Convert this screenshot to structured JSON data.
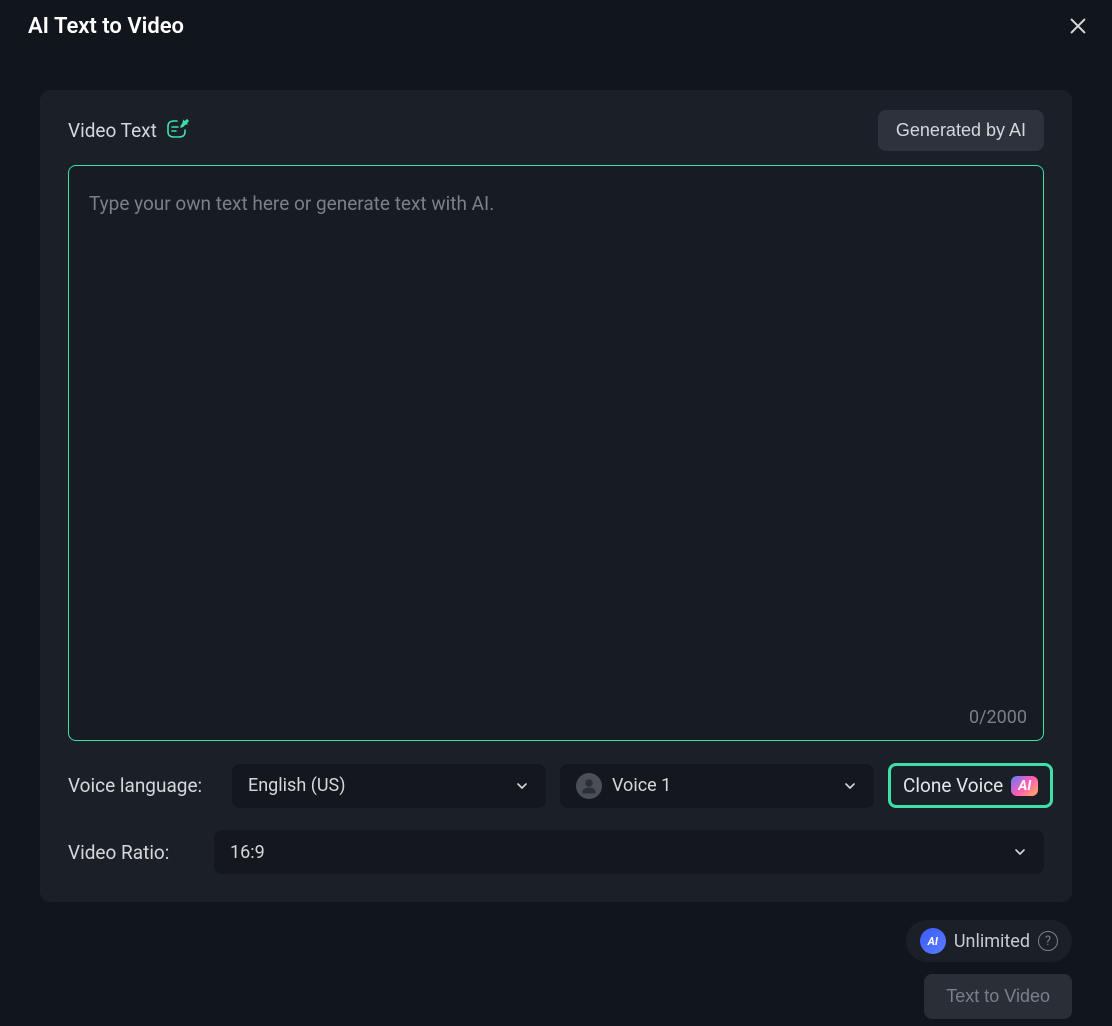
{
  "header": {
    "title": "AI Text to Video"
  },
  "videoText": {
    "label": "Video Text",
    "generateButton": "Generated by AI",
    "placeholder": "Type your own text here or generate text with AI.",
    "value": "",
    "counter": "0/2000"
  },
  "voice": {
    "languageLabel": "Voice language:",
    "languageSelected": "English (US)",
    "voiceSelected": "Voice 1",
    "cloneLabel": "Clone Voice",
    "aiBadge": "AI"
  },
  "ratio": {
    "label": "Video Ratio:",
    "selected": "16:9"
  },
  "footer": {
    "unlimited": "Unlimited",
    "aiBadge": "AI",
    "submitLabel": "Text to Video"
  }
}
